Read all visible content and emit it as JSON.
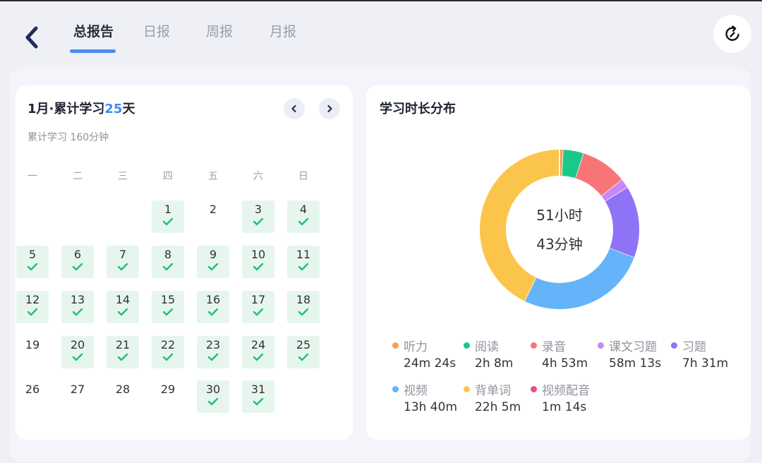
{
  "header": {
    "tabs": [
      "总报告",
      "日报",
      "周报",
      "月报"
    ],
    "accent": "#4a8ef0"
  },
  "calendar": {
    "title_prefix": "1月·累计学习",
    "title_days": "25",
    "title_suffix": "天",
    "subtitle": "累计学习 160分钟",
    "weekdays": [
      "一",
      "二",
      "三",
      "四",
      "五",
      "六",
      "日"
    ],
    "days": [
      {
        "d": "1",
        "done": true
      },
      {
        "d": "2",
        "done": false
      },
      {
        "d": "3",
        "done": true
      },
      {
        "d": "4",
        "done": true
      },
      {
        "d": "5",
        "done": true
      },
      {
        "d": "6",
        "done": true
      },
      {
        "d": "7",
        "done": true
      },
      {
        "d": "8",
        "done": true
      },
      {
        "d": "9",
        "done": true
      },
      {
        "d": "10",
        "done": true
      },
      {
        "d": "11",
        "done": true
      },
      {
        "d": "12",
        "done": true
      },
      {
        "d": "13",
        "done": true
      },
      {
        "d": "14",
        "done": true
      },
      {
        "d": "15",
        "done": true
      },
      {
        "d": "16",
        "done": true
      },
      {
        "d": "17",
        "done": true
      },
      {
        "d": "18",
        "done": true
      },
      {
        "d": "19",
        "done": false
      },
      {
        "d": "20",
        "done": true
      },
      {
        "d": "21",
        "done": true
      },
      {
        "d": "22",
        "done": true
      },
      {
        "d": "23",
        "done": true
      },
      {
        "d": "24",
        "done": true
      },
      {
        "d": "25",
        "done": true
      },
      {
        "d": "26",
        "done": false
      },
      {
        "d": "27",
        "done": false
      },
      {
        "d": "28",
        "done": false
      },
      {
        "d": "29",
        "done": false
      },
      {
        "d": "30",
        "done": true
      },
      {
        "d": "31",
        "done": true
      }
    ],
    "done_color": "#1fbf74"
  },
  "distribution": {
    "title": "学习时长分布",
    "total_hours": "51小时",
    "total_minutes": "43分钟",
    "items": [
      {
        "label": "听力",
        "value": "24m 24s",
        "minutes": 24.4,
        "color": "#f5a057"
      },
      {
        "label": "阅读",
        "value": "2h 8m",
        "minutes": 128,
        "color": "#19c98a"
      },
      {
        "label": "录音",
        "value": "4h 53m",
        "minutes": 293,
        "color": "#f87577"
      },
      {
        "label": "课文习题",
        "value": "58m 13s",
        "minutes": 58.2,
        "color": "#c986f6"
      },
      {
        "label": "习题",
        "value": "7h 31m",
        "minutes": 451,
        "color": "#8f73f7"
      },
      {
        "label": "视频",
        "value": "13h 40m",
        "minutes": 820,
        "color": "#65b3f9"
      },
      {
        "label": "背单词",
        "value": "22h 5m",
        "minutes": 1325,
        "color": "#fbc54c"
      },
      {
        "label": "视频配音",
        "value": "1m 14s",
        "minutes": 1.2,
        "color": "#ef4c83"
      }
    ]
  }
}
